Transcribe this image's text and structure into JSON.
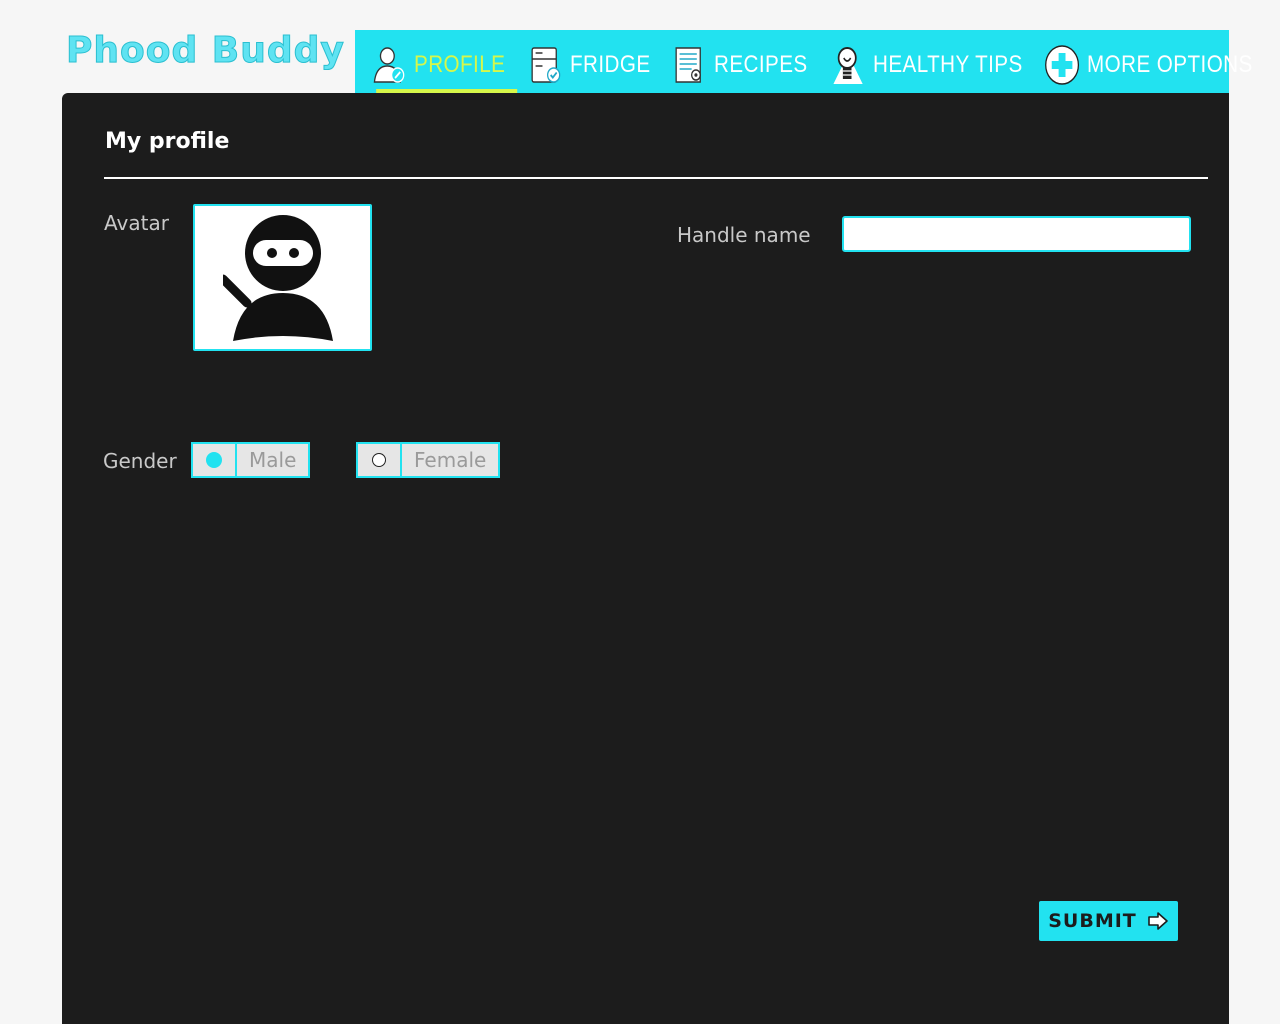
{
  "app": {
    "logo_text": "Phood Buddy"
  },
  "nav": {
    "items": [
      {
        "label": "PROFILE",
        "icon": "profile-icon",
        "active": true
      },
      {
        "label": "FRIDGE",
        "icon": "fridge-icon",
        "active": false
      },
      {
        "label": "RECIPES",
        "icon": "recipes-icon",
        "active": false
      },
      {
        "label": "HEALTHY TIPS",
        "icon": "lightbulb-icon",
        "active": false
      },
      {
        "label": "MORE OPTIONS",
        "icon": "plus-circle-icon",
        "active": false
      }
    ]
  },
  "profile": {
    "title": "My profile",
    "avatar_label": "Avatar",
    "avatar_icon": "ninja-avatar-icon",
    "handle_label": "Handle name",
    "handle_value": "",
    "gender_label": "Gender",
    "gender_options": [
      {
        "label": "Male",
        "selected": true
      },
      {
        "label": "Female",
        "selected": false
      }
    ],
    "submit_label": "SUBMIT"
  },
  "colors": {
    "accent": "#22e2f0",
    "active_nav": "#d6f74a",
    "panel_bg": "#1c1c1c",
    "page_bg": "#f6f6f6"
  }
}
